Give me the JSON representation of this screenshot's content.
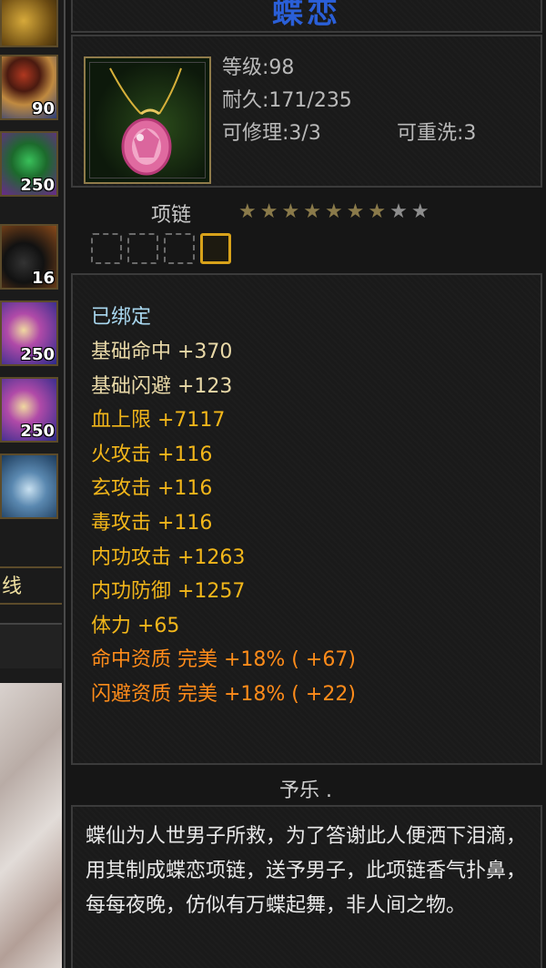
{
  "item": {
    "name": "蝶恋",
    "level": "等级:98",
    "durability": "耐久:171/235",
    "repairable": "可修理:3/3",
    "rewash": "可重洗:3",
    "type": "项链",
    "stars_filled": 7,
    "stars_total": 9,
    "sockets": 4,
    "sockets_filled": 1,
    "bound": "已绑定",
    "attributes": [
      {
        "label": "基础命中  +370",
        "color": "#e9d9a8"
      },
      {
        "label": "基础闪避  +123",
        "color": "#e9d9a8"
      },
      {
        "label": "血上限  +7117",
        "color": "#f2b61a"
      },
      {
        "label": "火攻击  +116",
        "color": "#f2b61a"
      },
      {
        "label": "玄攻击  +116",
        "color": "#f2b61a"
      },
      {
        "label": "毒攻击  +116",
        "color": "#f2b61a"
      },
      {
        "label": "内功攻击  +1263",
        "color": "#f2b61a"
      },
      {
        "label": "内功防御  +1257",
        "color": "#f2b61a"
      },
      {
        "label": "体力  +65",
        "color": "#f2b61a"
      },
      {
        "label": "命中资质   完美  +18% ( +67)",
        "color": "#ff8c1a"
      },
      {
        "label": "闪避资质   完美  +18% ( +22)",
        "color": "#ff8c1a"
      }
    ],
    "author": "予乐 .",
    "description": "蝶仙为人世男子所救，为了答谢此人便洒下泪滴，用其制成蝶恋项链，送予男子，此项链香气扑鼻，每每夜晚，仿似有万蝶起舞，非人间之物。"
  },
  "inventory": {
    "counts": [
      "90",
      "250",
      "16",
      "250",
      "250"
    ],
    "label": "线"
  },
  "colors": {
    "title": "#2a5fd8",
    "star_filled": "#8a7a4a",
    "star_empty": "#8d8d8d",
    "bound": "#a9d8f0",
    "socket_active": "#d8a21a"
  }
}
